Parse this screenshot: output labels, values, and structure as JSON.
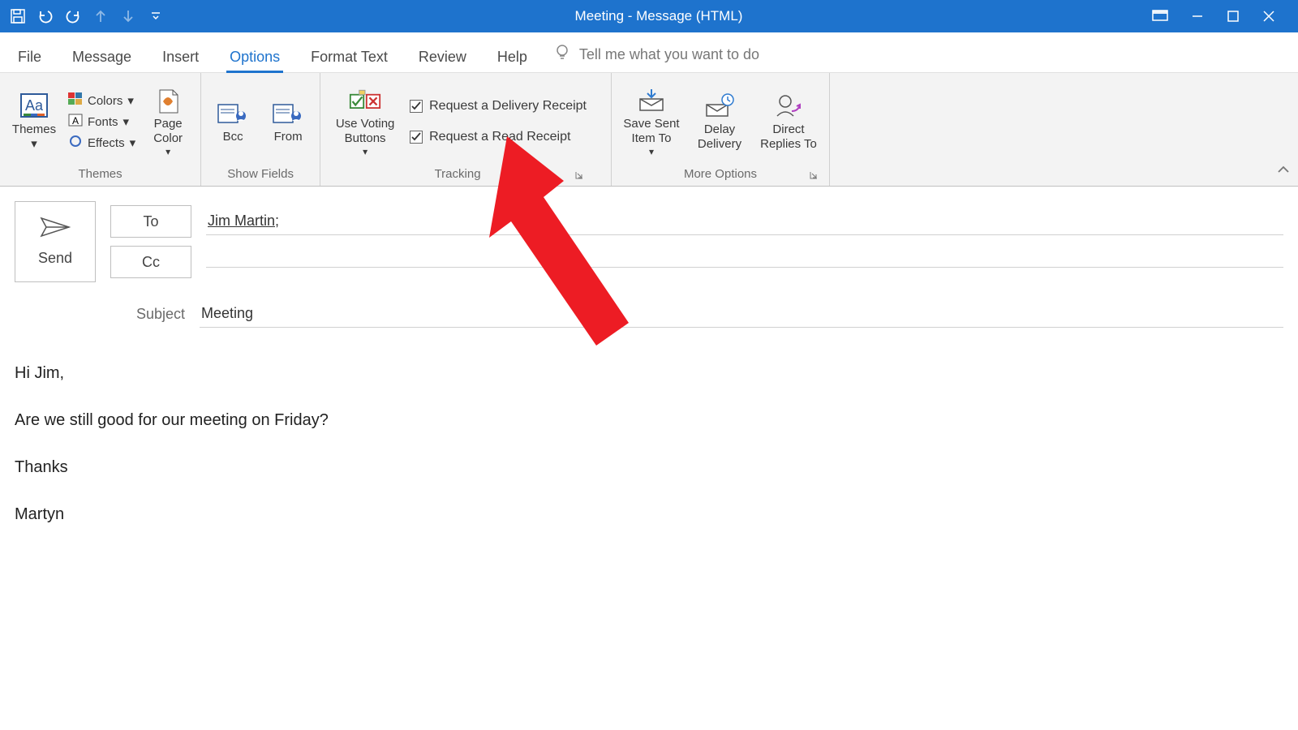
{
  "window": {
    "title": "Meeting  -  Message (HTML)"
  },
  "tabs": {
    "file": "File",
    "message": "Message",
    "insert": "Insert",
    "options": "Options",
    "format_text": "Format Text",
    "review": "Review",
    "help": "Help",
    "tellme_placeholder": "Tell me what you want to do"
  },
  "ribbon": {
    "themes": {
      "label": "Themes",
      "themes_btn": "Themes",
      "colors": "Colors",
      "fonts": "Fonts",
      "effects": "Effects",
      "page_color": "Page\nColor"
    },
    "show_fields": {
      "label": "Show Fields",
      "bcc": "Bcc",
      "from": "From"
    },
    "tracking": {
      "label": "Tracking",
      "voting": "Use Voting\nButtons",
      "req_delivery": "Request a Delivery Receipt",
      "req_read": "Request a Read Receipt"
    },
    "more_options": {
      "label": "More Options",
      "save_sent": "Save Sent\nItem To",
      "delay": "Delay\nDelivery",
      "replies": "Direct\nReplies To"
    }
  },
  "compose": {
    "send": "Send",
    "to_label": "To",
    "cc_label": "Cc",
    "subject_label": "Subject",
    "to_value": "Jim Martin",
    "cc_value": "",
    "subject_value": "Meeting",
    "body_lines": [
      "Hi Jim,",
      "Are we still good for our meeting on Friday?",
      "Thanks",
      "Martyn"
    ]
  }
}
